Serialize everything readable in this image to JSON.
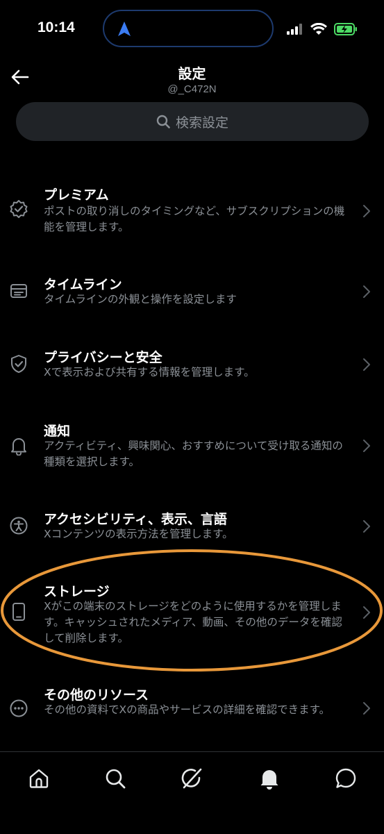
{
  "status_bar": {
    "time": "10:14",
    "battery_color": "#4cd964"
  },
  "header": {
    "title": "設定",
    "subtitle": "@_C472N"
  },
  "search": {
    "placeholder": "検索設定"
  },
  "items": [
    {
      "title": "プレミアム",
      "desc": "ポストの取り消しのタイミングなど、サブスクリプションの機能を管理します。",
      "icon": "verified-badge-icon"
    },
    {
      "title": "タイムライン",
      "desc": "タイムラインの外観と操作を設定します",
      "icon": "timeline-icon"
    },
    {
      "title": "プライバシーと安全",
      "desc": "Xで表示および共有する情報を管理します。",
      "icon": "shield-icon"
    },
    {
      "title": "通知",
      "desc": "アクティビティ、興味関心、おすすめについて受け取る通知の種類を選択します。",
      "icon": "bell-icon"
    },
    {
      "title": "アクセシビリティ、表示、言語",
      "desc": "Xコンテンツの表示方法を管理します。",
      "icon": "accessibility-icon"
    },
    {
      "title": "ストレージ",
      "desc": "Xがこの端末のストレージをどのように使用するかを管理します。キャッシュされたメディア、動画、その他のデータを確認して削除します。",
      "icon": "device-icon"
    },
    {
      "title": "その他のリソース",
      "desc": "その他の資料でXの商品やサービスの詳細を確認できます。",
      "icon": "more-circle-icon"
    }
  ],
  "colors": {
    "background": "#000000",
    "text": "#e7e9ea",
    "secondary_text": "#8b9096",
    "annotation": "#e8983a"
  }
}
